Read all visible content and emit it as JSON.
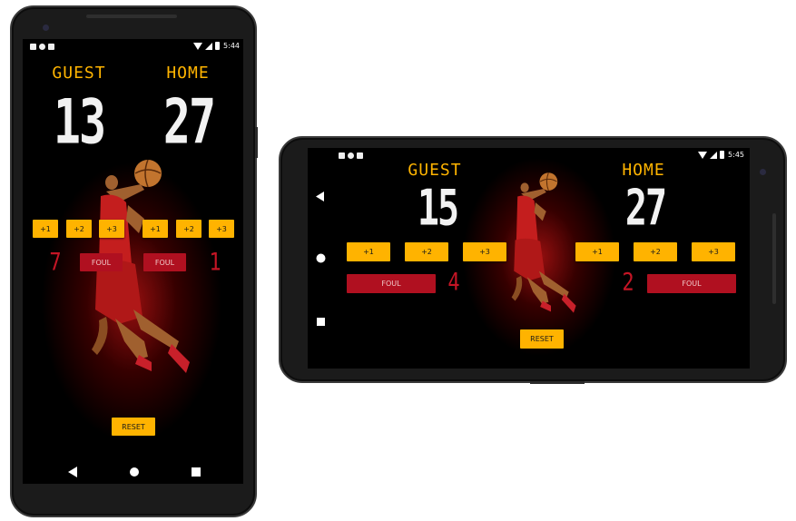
{
  "portrait": {
    "status": {
      "time": "5:44"
    },
    "guest": {
      "label": "GUEST",
      "score": "13",
      "fouls": "7"
    },
    "home": {
      "label": "HOME",
      "score": "27",
      "fouls": "1"
    },
    "buttons": {
      "plus1": "+1",
      "plus2": "+2",
      "plus3": "+3",
      "foul": "FOUL",
      "reset": "RESET"
    }
  },
  "landscape": {
    "status": {
      "time": "5:45"
    },
    "guest": {
      "label": "GUEST",
      "score": "15",
      "fouls": "4"
    },
    "home": {
      "label": "HOME",
      "score": "27",
      "fouls": "2"
    },
    "buttons": {
      "plus1": "+1",
      "plus2": "+2",
      "plus3": "+3",
      "foul": "FOUL",
      "reset": "RESET"
    }
  },
  "icons": {
    "nav_back": "back-triangle-icon",
    "nav_home": "home-circle-icon",
    "nav_recents": "recents-square-icon",
    "status": [
      "notification-icon",
      "sync-icon",
      "sd-card-icon",
      "wifi-icon",
      "cell-signal-icon",
      "battery-icon"
    ]
  },
  "colors": {
    "accent_yellow": "#ffb300",
    "label_yellow": "#ffb400",
    "foul_red": "#b01020",
    "foul_count_red": "#c41525",
    "score_white": "#f2f2f2",
    "background": "#000000"
  }
}
